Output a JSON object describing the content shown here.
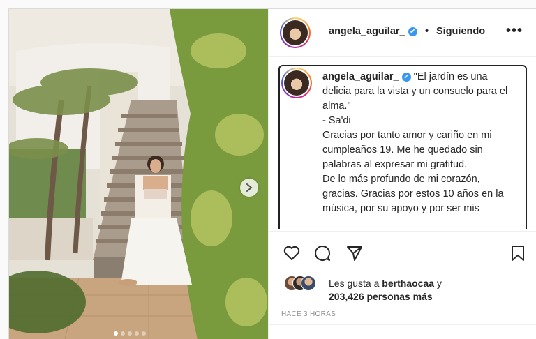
{
  "header": {
    "username": "angela_aguilar_",
    "separator": "•",
    "follow_status": "Siguiendo",
    "more": "•••"
  },
  "caption": {
    "username": "angela_aguilar_",
    "text": "\"El jardín es una delicia para la vista y un consuelo para el alma.\"\n- Sa'di\nGracias por tanto amor y cariño en mi cumpleaños 19. Me he quedado sin palabras al expresar mi gratitud.\nDe lo más profundo de mi corazón, gracias. Gracias por estos 10 años en la música, por su apoyo y por ser mis"
  },
  "likes": {
    "prefix": "Les gusta a",
    "user": "berthaocaa",
    "conj": "y",
    "count": "203,426 personas más"
  },
  "timestamp": "HACE 3 HORAS",
  "carousel": {
    "total": 5,
    "active": 1
  },
  "colors": {
    "verified": "#3897f0",
    "text": "#262626",
    "muted": "#8e8e8e"
  },
  "icons": [
    "heart-icon",
    "comment-icon",
    "share-icon",
    "bookmark-icon",
    "chevron-right-icon",
    "verified-badge-icon"
  ]
}
